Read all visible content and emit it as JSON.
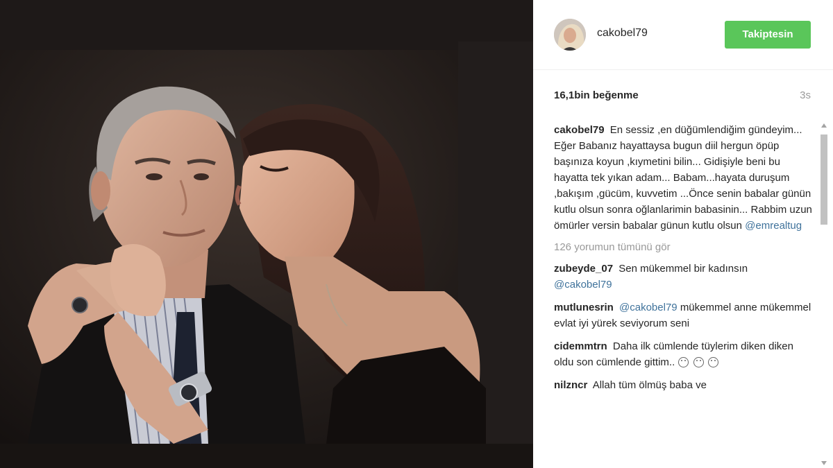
{
  "post": {
    "username": "cakobel79",
    "follow_label": "Takiptesin",
    "likes": "16,1bin beğenme",
    "time_ago": "3s",
    "caption": {
      "user": "cakobel79",
      "text": "En sessiz ,en düğümlendiğim gündeyim... Eğer Babanız hayattaysa bugun diil hergun öpüp başınıza koyun ,kıymetini bilin... Gidişiyle beni bu hayatta tek yıkan adam... Babam...hayata duruşum ,bakışım ,gücüm, kuvvetim ...Önce senin babalar günün kutlu olsun sonra oğlanlarimin babasinin... Rabbim uzun ömürler versin babalar günun kutlu olsun",
      "mention": "@emrealtug"
    },
    "load_more": "126 yorumun tümünü gör"
  },
  "comments": [
    {
      "user": "zubeyde_07",
      "text": "Sen mükemmel bir kadınsın",
      "mention": "@cakobel79",
      "prefix_mention": ""
    },
    {
      "user": "mutlunesrin",
      "prefix_mention": "@cakobel79",
      "text": "mükemmel anne mükemmel evlat iyi yürek seviyorum seni",
      "mention": ""
    },
    {
      "user": "cidemmtrn",
      "text": "Daha ilk cümlende tüylerim diken diken oldu son cümlende gittim..",
      "mention": "",
      "prefix_mention": ""
    },
    {
      "user": "nilzncr",
      "text": "Allah tüm ölmüş baba ve",
      "mention": "",
      "prefix_mention": ""
    }
  ],
  "icons": {
    "emoji": "sad-face-icon",
    "scroll_up": "scroll-up-arrow-icon",
    "scroll_down": "scroll-down-arrow-icon"
  },
  "colors": {
    "follow_button": "#5ac65a",
    "mention": "#3f729b",
    "muted": "#999999"
  }
}
